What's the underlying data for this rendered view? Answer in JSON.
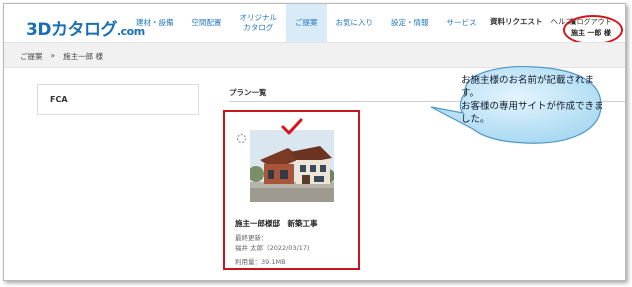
{
  "header": {
    "logo_main": "3Dカタログ",
    "logo_suffix": ".com",
    "nav": [
      {
        "label": "建材・設備"
      },
      {
        "label": "空間配置"
      },
      {
        "label": "オリジナル\nカタログ"
      },
      {
        "label": "ご提案"
      },
      {
        "label": "お気に入り"
      },
      {
        "label": "設定・情報"
      },
      {
        "label": "サービス"
      }
    ],
    "request_label": "資料リクエスト",
    "help_label": "ヘルプ",
    "logout_label": "ログアウト",
    "user_name": "施主 一郎 様"
  },
  "breadcrumb": {
    "items": [
      "ご提案",
      "»",
      "施主一郎 様"
    ]
  },
  "sidebar": {
    "label": "FCA"
  },
  "plans": {
    "title": "プラン一覧",
    "card": {
      "name": "施主一郎様邸　新築工事",
      "updated_label": "最終更新：",
      "updated_value": "福井 太郎（2022/03/17)",
      "usage": "利用量：39.1MB"
    }
  },
  "callout": {
    "text": "お施主様のお名前が記載されます。\nお客様の専用サイトが作成できました。"
  },
  "colors": {
    "brand": "#1b6fb5",
    "nav_active_bg": "#d8ebf7",
    "highlight_red": "#c4161c",
    "callout_fill": "#bfe3f7"
  }
}
